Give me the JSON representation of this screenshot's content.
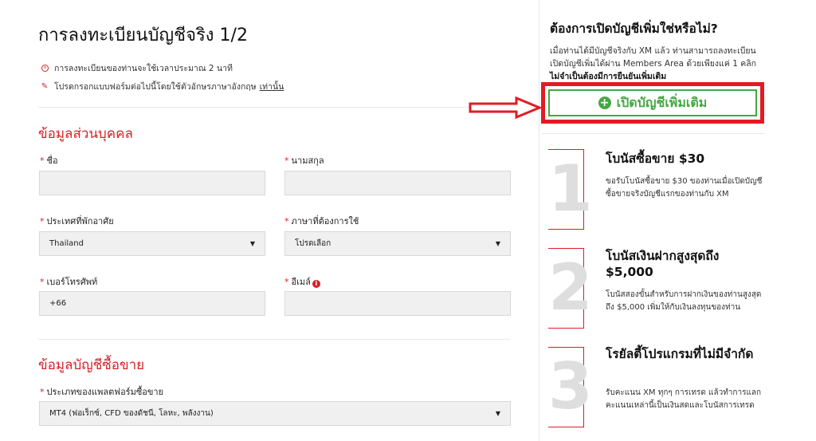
{
  "page": {
    "title": "การลงทะเบียนบัญชีจริง 1/2",
    "notice_time": "การลงทะเบียนของท่านจะใช้เวลาประมาณ 2 นาที",
    "notice_english": "โปรดกรอกแบบฟอร์มต่อไปนี้โดยใช้ตัวอักษรภาษาอังกฤษ",
    "notice_english_link": "เท่านั้น"
  },
  "personal": {
    "section_title": "ข้อมูลส่วนบุคคล",
    "first_name_label": "ชื่อ",
    "first_name_value": "",
    "last_name_label": "นามสกุล",
    "last_name_value": "",
    "country_label": "ประเทศที่พักอาศัย",
    "country_value": "Thailand",
    "language_label": "ภาษาที่ต้องการใช้",
    "language_value": "โปรดเลือก",
    "phone_label": "เบอร์โทรศัพท์",
    "phone_value": "+66",
    "email_label": "อีเมล์",
    "email_value": ""
  },
  "trading": {
    "section_title": "ข้อมูลบัญชีซื้อขาย",
    "platform_label": "ประเภทของแพลตฟอร์มซื้อขาย",
    "platform_value": "MT4 (ฟอเร็กซ์, CFD ของดัชนี, โลหะ, พลังงาน)"
  },
  "sidebar": {
    "title": "ต้องการเปิดบัญชีเพิ่มใช่หรือไม่?",
    "line1": "เมื่อท่านได้มีบัญชีจริงกับ XM แล้ว ท่านสามารถลงทะเบียน",
    "line2": "เปิดบัญชีเพิ่มได้ผ่าน Members Area ด้วยเพียงแค่ 1 คลิก",
    "line3": "ไม่จำเป็นต้องมีการยืนยันเพิ่มเติม",
    "button_label": "เปิดบัญชีเพิ่มเติม"
  },
  "bonuses": [
    {
      "number": "1",
      "title": "โบนัสซื้อขาย $30",
      "text": "ขอรับโบนัสซื้อขาย $30 ของท่านเมื่อเปิดบัญชีซื้อขายจริงบัญชีแรกของท่านกับ XM"
    },
    {
      "number": "2",
      "title": "โบนัสเงินฝากสูงสุดถึง $5,000",
      "text": "โบนัสสองขั้นสำหรับการฝากเงินของท่านสูงสุดถึง $5,000 เพิ่มให้กับเงินลงทุนของท่าน"
    },
    {
      "number": "3",
      "title": "โรยัลตี้โปรแกรมที่ไม่มีจำกัด",
      "text": "รับคะแนน XM ทุกๆ การเทรด แล้วทำการแลกคะแนนเหล่านี้เป็นเงินสดและโบนัสการเทรด"
    }
  ],
  "colors": {
    "accent_red": "#d62027",
    "button_green": "#44a842",
    "field_bg": "#f0f0f0"
  }
}
